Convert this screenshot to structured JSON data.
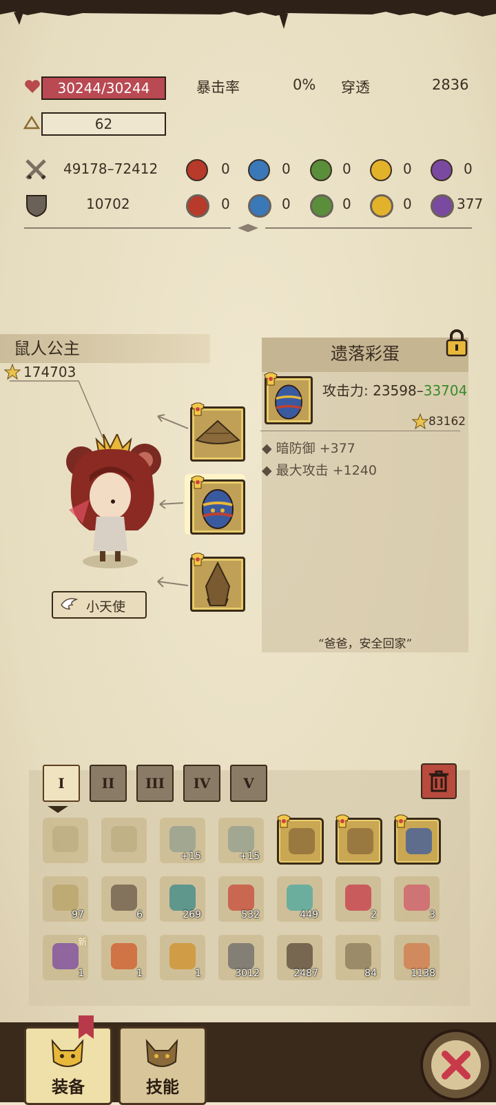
{
  "stats": {
    "hp": "30244/30244",
    "level": "62",
    "crit_label": "暴击率",
    "crit_value": "0%",
    "pierce_label": "穿透",
    "pierce_value": "2836",
    "attack": "49178–72412",
    "defense": "10702",
    "attack_elements": [
      "0",
      "0",
      "0",
      "0",
      "0"
    ],
    "defense_elements": [
      "0",
      "0",
      "0",
      "0",
      "377"
    ]
  },
  "element_colors": [
    "#b83a2a",
    "#3a78b8",
    "#5a8e3a",
    "#e2b22a",
    "#7a4aa0"
  ],
  "character": {
    "name": "鼠人公主",
    "rating": "174703",
    "title_badge": "小天使"
  },
  "item_panel": {
    "name": "遗落彩蛋",
    "attack_label": "攻击力: 23598–",
    "attack_max": "33704",
    "rating": "83162",
    "bonus1": "暗防御 +377",
    "bonus2": "最大攻击 +1240",
    "quote": "“爸爸，安全回家”"
  },
  "tabs": [
    "I",
    "II",
    "III",
    "IV",
    "V"
  ],
  "inventory": {
    "row1": [
      {
        "icon": "scroll-sword-icon",
        "count": ""
      },
      {
        "icon": "scroll-sword-icon",
        "count": ""
      },
      {
        "icon": "gem-upgrade-icon",
        "count": "+15"
      },
      {
        "icon": "gem-upgrade-icon",
        "count": "+15"
      },
      {
        "icon": "broom-weapon-icon",
        "count": ""
      },
      {
        "icon": "broom-weapon-icon",
        "count": ""
      },
      {
        "icon": "blue-hat-icon",
        "count": ""
      }
    ],
    "row2": [
      {
        "icon": "scroll-icon",
        "count": "97"
      },
      {
        "icon": "pickaxe-icon",
        "count": "6"
      },
      {
        "icon": "eye-scroll-icon",
        "count": "269"
      },
      {
        "icon": "red-potion-icon",
        "count": "532"
      },
      {
        "icon": "teal-potion-icon",
        "count": "449"
      },
      {
        "icon": "red-flask-icon",
        "count": "2"
      },
      {
        "icon": "star-potion-icon",
        "count": "3"
      }
    ],
    "row3": [
      {
        "icon": "purple-bag-icon",
        "count": "1",
        "badge": "新"
      },
      {
        "icon": "fire-gem-icon",
        "count": "1"
      },
      {
        "icon": "gold-badge-icon",
        "count": "1"
      },
      {
        "icon": "stone-block-icon",
        "count": "3012"
      },
      {
        "icon": "chest-icon",
        "count": "2487"
      },
      {
        "icon": "shovel-icon",
        "count": "84"
      },
      {
        "icon": "bowl-icon",
        "count": "1138"
      }
    ]
  },
  "bottom_nav": {
    "equip": "装备",
    "skills": "技能"
  }
}
